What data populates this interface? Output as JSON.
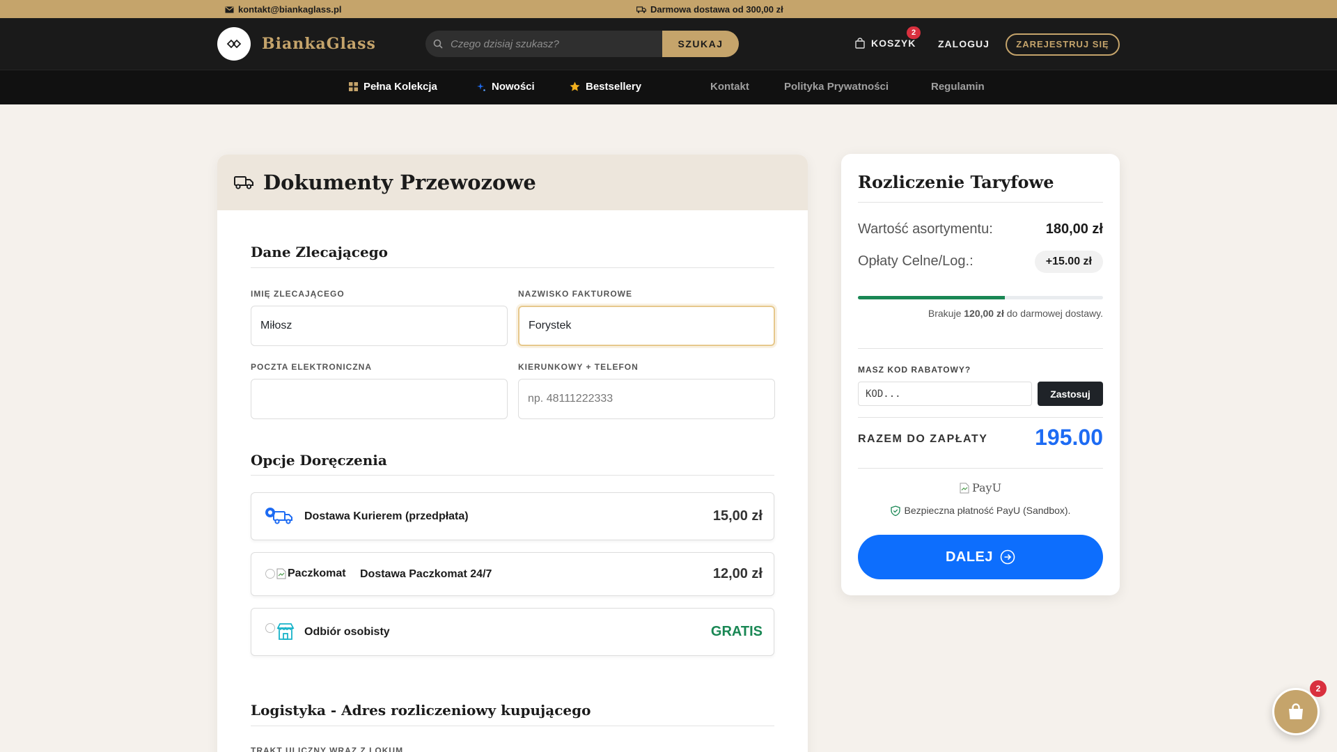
{
  "topbar": {
    "email": "kontakt@biankaglass.pl",
    "shipping_note": "Darmowa dostawa od 300,00 zł"
  },
  "header": {
    "brand": "BiankaGlass",
    "search_placeholder": "Czego dzisiaj szukasz?",
    "search_button": "SZUKAJ",
    "cart_label": "KOSZYK",
    "cart_count": "2",
    "login_label": "ZALOGUJ",
    "register_label": "ZAREJESTRUJ SIĘ"
  },
  "nav": {
    "items": [
      {
        "label": "Pełna Kolekcja",
        "icon": "grid-icon"
      },
      {
        "label": "Nowości",
        "icon": "sparkle-icon"
      },
      {
        "label": "Bestsellery",
        "icon": "star-icon"
      },
      {
        "label": "Kontakt"
      },
      {
        "label": "Polityka Prywatności"
      },
      {
        "label": "Regulamin"
      }
    ]
  },
  "form": {
    "title": "Dokumenty Przewozowe",
    "section_customer": "Dane Zlecającego",
    "first_name_label": "IMIĘ ZLECAJĄCEGO",
    "first_name_value": "Miłosz",
    "last_name_label": "NAZWISKO FAKTUROWE",
    "last_name_value": "Forystek",
    "email_label": "POCZTA ELEKTRONICZNA",
    "email_value": "",
    "phone_label": "KIERUNKOWY + TELEFON",
    "phone_placeholder": "np. 48111222333",
    "section_delivery": "Opcje Doręczenia",
    "delivery_options": [
      {
        "name": "Dostawa Kurierem (przedpłata)",
        "price": "15,00 zł",
        "selected": true,
        "icon": "truck-icon"
      },
      {
        "name": "Dostawa Paczkomat 24/7",
        "price": "12,00 zł",
        "selected": false,
        "icon_alt": "Paczkomat"
      },
      {
        "name": "Odbiór osobisty",
        "price": "GRATIS",
        "selected": false,
        "icon": "store-icon"
      }
    ],
    "section_address": "Logistyka - Adres rozliczeniowy kupującego",
    "street_label": "TRAKT ULICZNY WRAZ Z LOKUM"
  },
  "summary": {
    "title": "Rozliczenie Taryfowe",
    "goods_label": "Wartość asortymentu:",
    "goods_value": "180,00 zł",
    "fees_label": "Opłaty Celne/Log.:",
    "fees_value": "+15.00 zł",
    "progress_fraction": 0.6,
    "remaining_prefix": "Brakuje ",
    "remaining_amount": "120,00 zł",
    "remaining_suffix": " do darmowej dostawy.",
    "promo_label": "MASZ KOD RABATOWY?",
    "promo_placeholder": "KOD...",
    "promo_button": "Zastosuj",
    "total_label": "RAZEM DO ZAPŁATY",
    "total_value": "195.00",
    "payu_alt": "PayU",
    "secure_note": "Bezpieczna płatność PayU (Sandbox).",
    "next_button": "DALEJ"
  },
  "floating_cart": {
    "count": "2"
  },
  "colors": {
    "gold": "#c5a46b",
    "dark": "#1a1a1a",
    "blue": "#0d6efd",
    "green": "#198754",
    "badge_red": "#d9303e"
  }
}
